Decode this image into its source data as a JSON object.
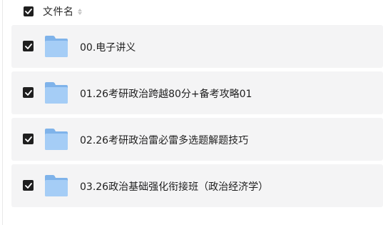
{
  "header": {
    "select_all_checked": true,
    "column_label": "文件名"
  },
  "files": [
    {
      "name": "00.电子讲义",
      "checked": true,
      "icon": "folder-icon"
    },
    {
      "name": "01.26考研政治跨越80分+备考攻略01",
      "checked": true,
      "icon": "folder-icon"
    },
    {
      "name": "02.26考研政治雷必雷多选题解题技巧",
      "checked": true,
      "icon": "folder-icon"
    },
    {
      "name": "03.26政治基础强化衔接班（政治经济学）",
      "checked": true,
      "icon": "folder-icon"
    }
  ],
  "colors": {
    "checkbox_fill": "#1f1f1f",
    "row_background": "#f4f4f5",
    "folder_back": "#7fb3ea",
    "folder_front": "#a5cdf6"
  }
}
